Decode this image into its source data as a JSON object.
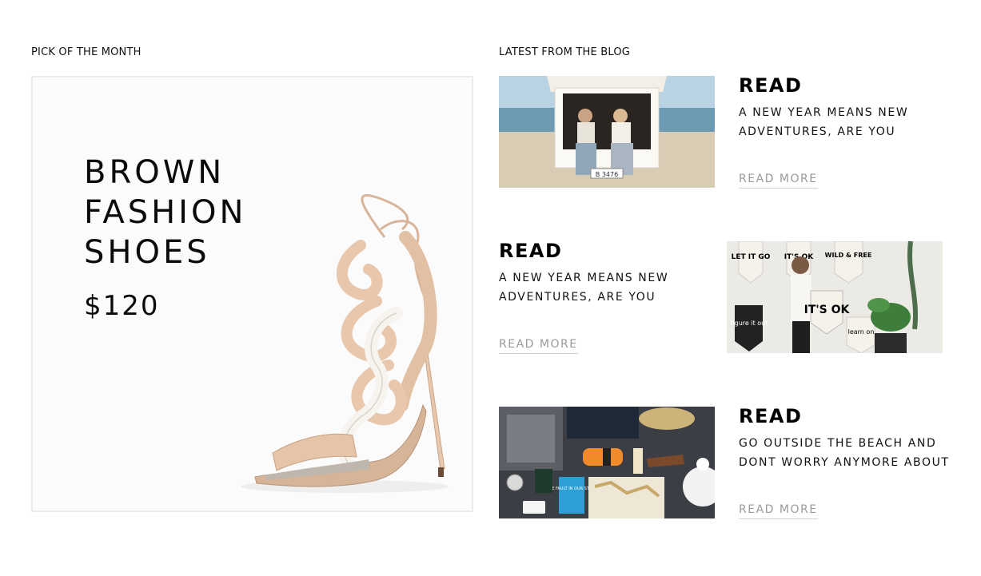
{
  "pick": {
    "label": "PICK OF THE MONTH",
    "title": "BROWN\nFASHION\nSHOES",
    "price": "$120",
    "image_icon": "high-heel-sandal"
  },
  "blog": {
    "label": "LATEST FROM THE BLOG",
    "posts": [
      {
        "heading": "READ",
        "excerpt": "A NEW YEAR MEANS NEW ADVENTURES, ARE YOU",
        "cta": "READ MORE",
        "image": "van-friends-photo",
        "plate": "B 3476"
      },
      {
        "heading": "READ",
        "excerpt": "A NEW YEAR MEANS NEW ADVENTURES, ARE YOU",
        "cta": "READ MORE",
        "image": "banners-photo",
        "banners": [
          "LET IT GO",
          "IT'S OK",
          "WILD & FREE",
          "IT'S OK",
          "figure it out",
          "learn on"
        ]
      },
      {
        "heading": "READ",
        "excerpt": "GO OUTSIDE THE BEACH AND DONT WORRY ANYMORE ABOUT",
        "cta": "READ MORE",
        "image": "travel-flatlay-photo",
        "book_title": "THE FAULT IN OUR STARS"
      }
    ]
  }
}
